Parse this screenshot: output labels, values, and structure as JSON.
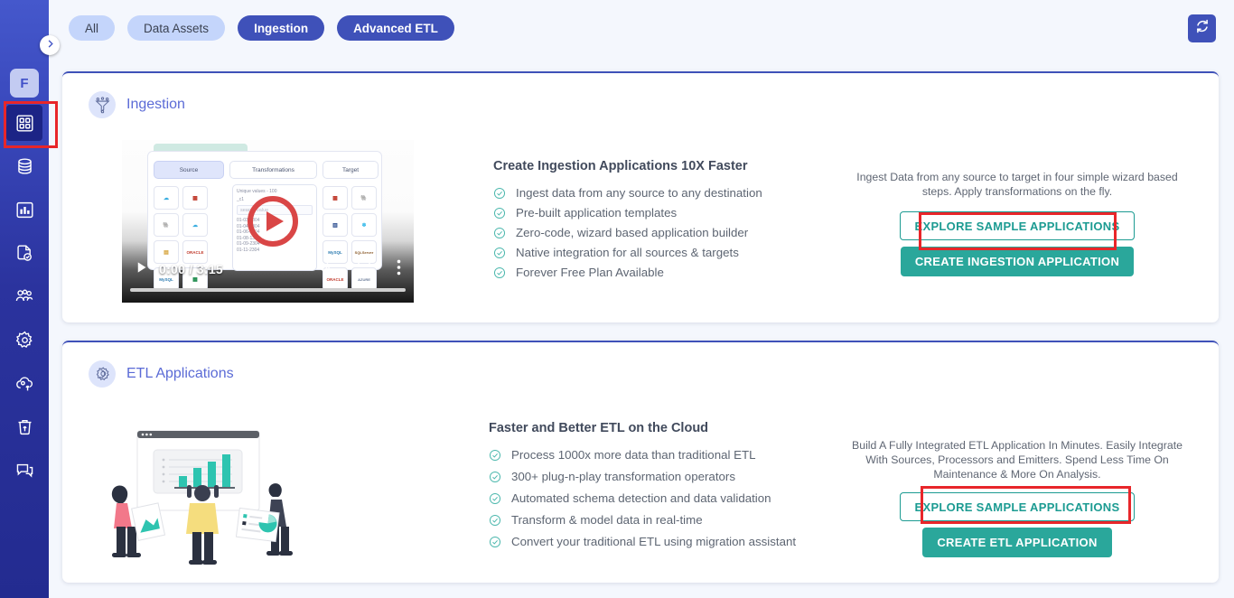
{
  "sidebar": {
    "avatar_label": "F",
    "expand_icon": "chevron-right-icon",
    "items": [
      {
        "icon": "dashboard-grid-icon",
        "name": "dashboard",
        "active": true,
        "annotated": true
      },
      {
        "icon": "database-icon",
        "name": "data-sources",
        "active": false,
        "annotated": false
      },
      {
        "icon": "bar-chart-icon",
        "name": "analytics",
        "active": false,
        "annotated": false
      },
      {
        "icon": "document-check-icon",
        "name": "reports",
        "active": false,
        "annotated": false
      },
      {
        "icon": "users-icon",
        "name": "users",
        "active": false,
        "annotated": false
      },
      {
        "icon": "gear-icon",
        "name": "settings",
        "active": false,
        "annotated": false
      },
      {
        "icon": "cloud-upload-icon",
        "name": "deployments",
        "active": false,
        "annotated": false
      },
      {
        "icon": "trash-upload-icon",
        "name": "recycle-bin",
        "active": false,
        "annotated": false
      },
      {
        "icon": "chat-icon",
        "name": "support-chat",
        "active": false,
        "annotated": false
      }
    ]
  },
  "topbar": {
    "filters": [
      {
        "label": "All",
        "selected": false
      },
      {
        "label": "Data Assets",
        "selected": false
      },
      {
        "label": "Ingestion",
        "selected": true
      },
      {
        "label": "Advanced ETL",
        "selected": true
      }
    ],
    "refresh_icon": "refresh-icon"
  },
  "ingestion_card": {
    "header": {
      "icon": "funnel-ingestion-icon",
      "title": "Ingestion"
    },
    "video": {
      "time_display": "0:00 / 3:15",
      "play_icon": "play-icon",
      "volume_icon": "volume-icon",
      "fullscreen_icon": "fullscreen-icon",
      "more_icon": "kebab-menu-icon",
      "thumb": {
        "tabs": [
          "Source",
          "Transformations",
          "Target"
        ],
        "panel_label": "Unique values - 100",
        "field_value": "_c1",
        "search_placeholder": "search value",
        "rows": [
          "01-03-2304",
          "01-04-2304",
          "01-06-2304",
          "01-08-1301",
          "01-09-2304",
          "01-11-2304"
        ],
        "source_icons": [
          "salesforce",
          "redshift",
          "postgres",
          "cloud",
          "files",
          "ORACLE",
          "MySQL",
          "sheets"
        ],
        "target_icons": [
          "redshift",
          "postgres",
          "bigdata",
          "snowflake",
          "MySQL",
          "SQLServer",
          "ORACLE",
          "AZURE"
        ]
      }
    },
    "features": {
      "title": "Create Ingestion Applications 10X Faster",
      "items": [
        "Ingest data from any source to any destination",
        "Pre-built application templates",
        "Zero-code, wizard based application builder",
        "Native integration for all sources & targets",
        "Forever Free Plan Available"
      ]
    },
    "cta": {
      "description": "Ingest Data from any source to target in four simple wizard based steps. Apply transformations on the fly.",
      "secondary_label": "EXPLORE SAMPLE APPLICATIONS",
      "primary_label": "CREATE INGESTION APPLICATION"
    }
  },
  "etl_card": {
    "header": {
      "icon": "etl-gear-icon",
      "title": "ETL Applications"
    },
    "features": {
      "title": "Faster and Better ETL on the Cloud",
      "items": [
        "Process 1000x more data than traditional ETL",
        "300+ plug-n-play transformation operators",
        "Automated schema detection and data validation",
        "Transform & model data in real-time",
        "Convert your traditional ETL using migration assistant"
      ]
    },
    "cta": {
      "description": "Build A Fully Integrated ETL Application In Minutes. Easily Integrate With Sources, Processors and Emitters. Spend Less Time On Maintenance & More On Analysis.",
      "secondary_label": "EXPLORE SAMPLE APPLICATIONS",
      "primary_label": "CREATE ETL APPLICATION"
    }
  },
  "colors": {
    "sidebar_blue": "#2b339e",
    "pill_active": "#3f51b9",
    "pill_inactive": "#c4d5fb",
    "teal": "#2aa79b",
    "teal_outline": "#1c9b92",
    "annotation_red": "#e8262a",
    "page_bg": "#f4f7fd",
    "title_blue": "#5b6bd6"
  }
}
